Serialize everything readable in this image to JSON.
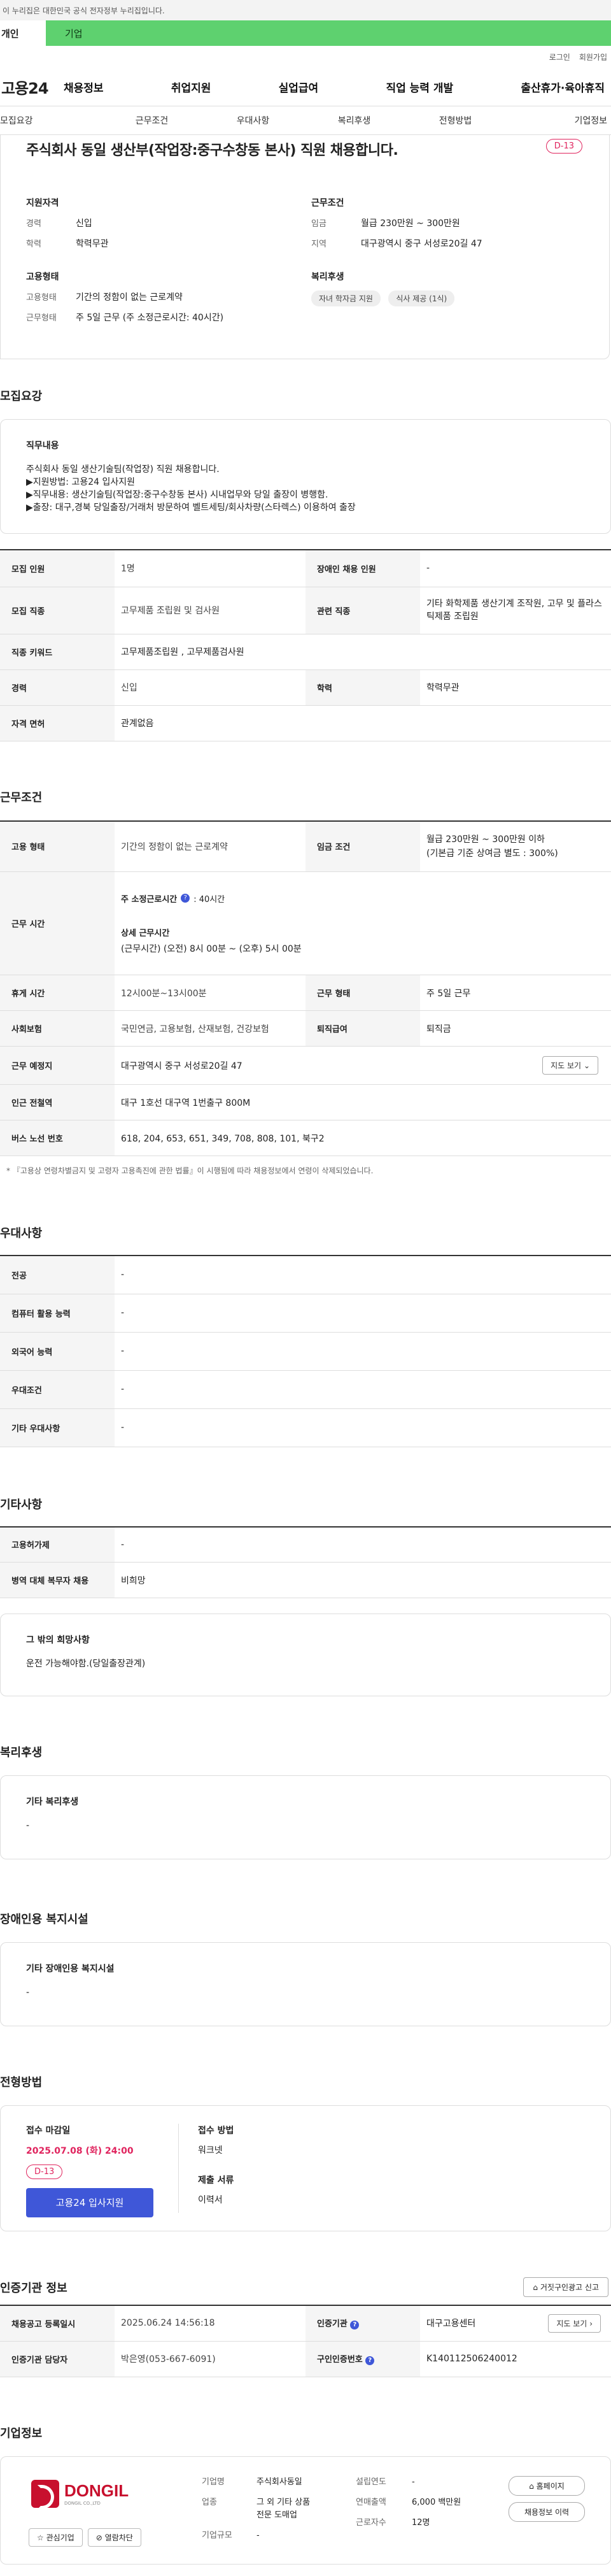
{
  "gov_bar": "이 누리집은 대한민국 공식 전자정부 누리집입니다.",
  "gnb": {
    "individual": "개인",
    "corporate": "기업"
  },
  "util": [
    "로그인",
    "회원가입"
  ],
  "logo": "고용24",
  "menu": [
    "채용정보",
    "취업지원",
    "실업급여",
    "직업 능력 개발",
    "출산휴가·육아휴직"
  ],
  "tabs": [
    "모집요강",
    "근무조건",
    "우대사항",
    "복리후생",
    "전형방법",
    "기업정보"
  ],
  "summary": {
    "title": "주식회사 동일 생산부(작업장:중구수창동 본사) 직원 채용합니다.",
    "dday": "D-13",
    "qual_title": "지원자격",
    "career_k": "경력",
    "career_v": "신입",
    "edu_k": "학력",
    "edu_v": "학력무관",
    "work_title": "근무조건",
    "wage_k": "임금",
    "wage_v": "월급 230만원 ~ 300만원",
    "area_k": "지역",
    "area_v": "대구광역시 중구 서성로20길 47",
    "emp_title": "고용형태",
    "emptype_k": "고용형태",
    "emptype_v": "기간의 정함이 없는 근로계약",
    "hours_k": "근무형태",
    "hours_v": "주 5일 근무 (주 소정근로시간: 40시간)",
    "welfare_title": "복리후생",
    "chips": [
      "자녀 학자금 지원",
      "식사 제공 (1식)"
    ]
  },
  "recruit": {
    "title": "모집요강",
    "job_title": "직무내용",
    "job_lines": [
      "주식회사 동일 생산기술팀(작업장) 직원 채용합니다.",
      "▶지원방법: 고용24 입사지원",
      "▶직무내용: 생산기술팀(작업장:중구수창동 본사) 시내업무와 당일 출장이 병행함.",
      "▶출장: 대구,경북 당일출장/거래처 방문하여 벨트세팅/회사차량(스타렉스) 이용하여 출장"
    ],
    "rows": [
      [
        "모집 인원",
        "1명",
        "장애인 채용 인원",
        "-"
      ],
      [
        "모집 직종",
        "고무제품 조립원 및 검사원",
        "관련 직종",
        "기타 화학제품 생산기계 조작원, 고무 및 플라스틱제품 조립원"
      ],
      [
        "직종 키워드",
        "고무제품조립원 , 고무제품검사원"
      ],
      [
        "경력",
        "신입",
        "학력",
        "학력무관"
      ],
      [
        "자격 면허",
        "관계없음"
      ]
    ]
  },
  "conditions": {
    "title": "근무조건",
    "emp_type_k": "고용 형태",
    "emp_type_v": "기간의 정함이 없는 근로계약",
    "wage_k": "임금 조건",
    "wage_v1": "월급 230만원 ~ 300만원 이하",
    "wage_v2": "(기본급 기준 상여금 별도 : 300%)",
    "time_k": "근무 시간",
    "time_weekly_label": "주 소정근로시간",
    "time_weekly_val": ": 40시간",
    "time_detail_label": "상세 근무시간",
    "time_detail_val": "(근무시간) (오전) 8시 00분 ~ (오후) 5시 00분",
    "rest_k": "휴게 시간",
    "rest_v": "12시00분~13시00분",
    "shift_k": "근무 형태",
    "shift_v": "주 5일 근무",
    "ins_k": "사회보험",
    "ins_v": "국민연금, 고용보험, 산재보험, 건강보험",
    "sev_k": "퇴직급여",
    "sev_v": "퇴직금",
    "place_k": "근무 예정지",
    "place_v": "대구광역시 중구 서성로20길 47",
    "map_btn": "지도 보기",
    "subway_k": "인근 전철역",
    "subway_v": "대구 1호선 대구역 1번출구 800M",
    "bus_k": "버스 노선 번호",
    "bus_v": "618, 204, 653, 651, 349, 708, 808, 101, 북구2",
    "note": "* 『고용상 연령차별금지 및 고령자 고용촉진에 관한 법률』이 시행됨에 따라 채용정보에서 연령이 삭제되었습니다."
  },
  "preference": {
    "title": "우대사항",
    "rows": [
      [
        "전공",
        "-"
      ],
      [
        "컴퓨터 활용 능력",
        "-"
      ],
      [
        "외국어 능력",
        "-"
      ],
      [
        "우대조건",
        "-"
      ],
      [
        "기타 우대사항",
        "-"
      ]
    ]
  },
  "etc": {
    "title": "기타사항",
    "rows": [
      [
        "고용허가제",
        "-"
      ],
      [
        "병역 대체 복무자 채용",
        "비희망"
      ]
    ],
    "box_title": "그 밖의 희망사항",
    "box_text": "운전 가능해야함.(당일출장관계)"
  },
  "welfare": {
    "title": "복리후생",
    "box_title": "기타 복리후생",
    "box_text": "-"
  },
  "disability": {
    "title": "장애인용 복지시설",
    "box_title": "기타 장애인용 복지시설",
    "box_text": "-"
  },
  "screening": {
    "title": "전형방법",
    "deadline_label": "접수 마감일",
    "deadline": "2025.07.08 (화) 24:00",
    "dday": "D-13",
    "apply_btn": "고용24 입사지원",
    "method_label": "접수 방법",
    "method": "워크넷",
    "docs_label": "제출 서류",
    "docs": "이력서"
  },
  "cert": {
    "title": "인증기관 정보",
    "report_btn": "거짓구인광고 신고",
    "reg_k": "채용공고 등록일시",
    "reg_v": "2025.06.24 14:56:18",
    "org_k": "인증기관",
    "org_v": "대구고용센터",
    "map_btn": "지도 보기",
    "mgr_k": "인증기관 담당자",
    "mgr_v": "박은영(053-667-6091)",
    "num_k": "구인인증번호",
    "num_v": "K140112506240012"
  },
  "company": {
    "title": "기업정보",
    "logo_text": "DONGIL",
    "logo_sub": "DONGIL CO.,LTD",
    "interest_btn": "관심기업",
    "block_btn": "열람차단",
    "name_k": "기업명",
    "name_v": "주식회사동일",
    "biz_k": "업종",
    "biz_v1": "그 외 기타 상품",
    "biz_v2": "전문 도매업",
    "size_k": "기업규모",
    "size_v": "-",
    "est_k": "설립연도",
    "est_v": "-",
    "sales_k": "연매출액",
    "sales_v": "6,000 백만원",
    "emp_k": "근로자수",
    "emp_v": "12명",
    "home_btn": "홈페이지",
    "history_btn": "채용정보 이력"
  }
}
